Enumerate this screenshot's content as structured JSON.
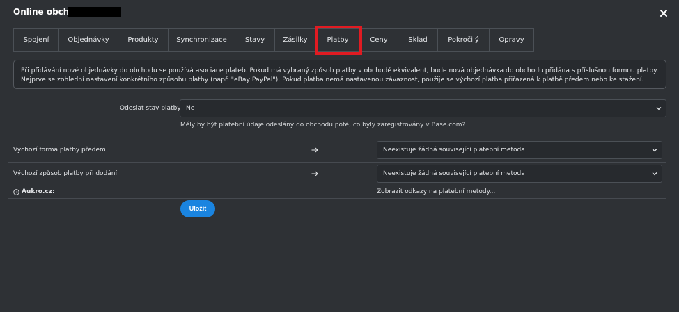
{
  "header": {
    "title": "Online obchod"
  },
  "tabs": [
    {
      "label": "Spojení",
      "active": false
    },
    {
      "label": "Objednávky",
      "active": false
    },
    {
      "label": "Produkty",
      "active": false
    },
    {
      "label": "Synchronizace",
      "active": false
    },
    {
      "label": "Stavy",
      "active": false
    },
    {
      "label": "Zásilky",
      "active": false
    },
    {
      "label": "Platby",
      "active": true
    },
    {
      "label": "Ceny",
      "active": false
    },
    {
      "label": "Sklad",
      "active": false
    },
    {
      "label": "Pokročilý",
      "active": false
    },
    {
      "label": "Opravy",
      "active": false
    }
  ],
  "info": {
    "line1": "Při přidávání nové objednávky do obchodu se používá asociace plateb. Pokud má vybraný způsob platby v obchodě ekvivalent, bude nová objednávka do obchodu přidána s příslušnou formou platby.",
    "line2": "Nejprve se zohlední nastavení konkrétního způsobu platby (např. \"eBay PayPal\"). Pokud platba nemá nastavenou závaznost, použije se výchozí platba přiřazená k platbě předem nebo ke stažení."
  },
  "send_status": {
    "label": "Odeslat stav platby",
    "value": "Ne",
    "hint": "Měly by být platební údaje odeslány do obchodu poté, co byly zaregistrovány v Base.com?"
  },
  "mappings": [
    {
      "label": "Výchozí forma platby předem",
      "value": "Neexistuje žádná související platební metoda"
    },
    {
      "label": "Výchozí způsob platby při dodání",
      "value": "Neexistuje žádná související platební metoda"
    }
  ],
  "aukro": {
    "label": "Aukro.cz:",
    "link": "Zobrazit odkazy na platební metody..."
  },
  "save_label": "Uložit",
  "colors": {
    "background": "#2e3135",
    "accent": "#1a84e0",
    "highlight": "#e11b22"
  }
}
